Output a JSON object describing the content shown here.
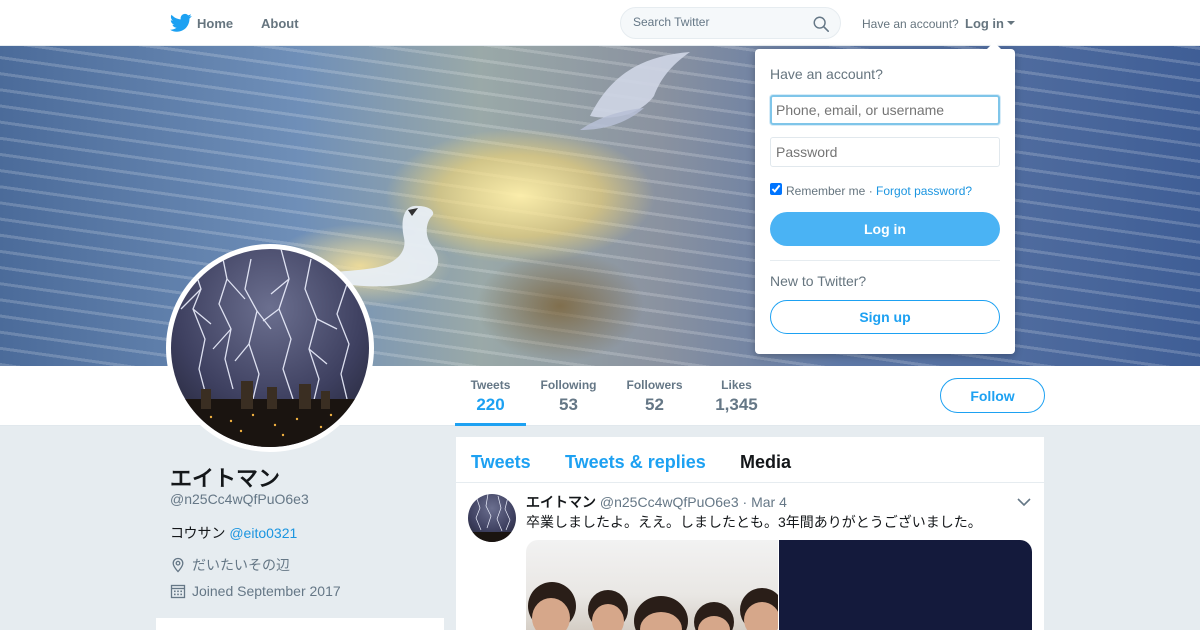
{
  "nav": {
    "home": "Home",
    "about": "About",
    "search_placeholder": "Search Twitter",
    "have_account": "Have an account?",
    "login": "Log in"
  },
  "login_dropdown": {
    "title": "Have an account?",
    "username_placeholder": "Phone, email, or username",
    "password_placeholder": "Password",
    "remember_me": "Remember me",
    "separator": "·",
    "forgot_password": "Forgot password?",
    "login_button": "Log in",
    "new_to_twitter": "New to Twitter?",
    "signup_button": "Sign up"
  },
  "stats": [
    {
      "label": "Tweets",
      "value": "220",
      "active": true
    },
    {
      "label": "Following",
      "value": "53",
      "active": false
    },
    {
      "label": "Followers",
      "value": "52",
      "active": false
    },
    {
      "label": "Likes",
      "value": "1,345",
      "active": false
    }
  ],
  "follow_button": "Follow",
  "profile": {
    "name": "エイトマン",
    "handle": "@n25Cc4wQfPuO6e3",
    "bio_text": "コウサン",
    "bio_mention": "@eito0321",
    "location": "だいたいその辺",
    "joined": "Joined September 2017"
  },
  "timeline": {
    "tabs": [
      "Tweets",
      "Tweets & replies",
      "Media"
    ],
    "current_tab": "Media"
  },
  "tweet": {
    "name": "エイトマン",
    "handle": "@n25Cc4wQfPuO6e3",
    "dot": "·",
    "time": "Mar 4",
    "text": "卒業しましたよ。ええ。しましたとも。3年間ありがとうございました。"
  },
  "colors": {
    "accent": "#1da1f2",
    "link": "#1b95e0",
    "page_bg": "#e6ecf0"
  }
}
